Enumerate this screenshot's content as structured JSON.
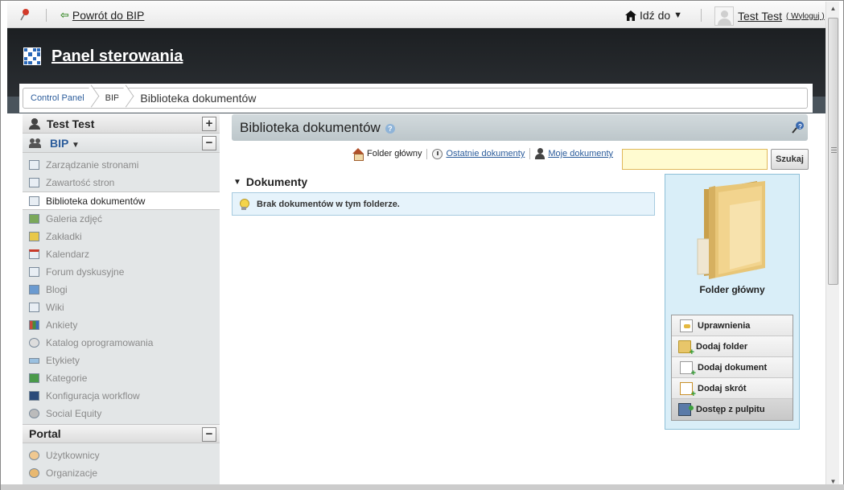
{
  "dock": {
    "back_label": "Powrót do BIP",
    "goto_label": "Idź do",
    "user_name": "Test Test",
    "logout_label": "( Wyloguj )"
  },
  "header": {
    "title": "Panel sterowania"
  },
  "breadcrumb": {
    "items": [
      "Control Panel",
      "BIP",
      "Biblioteka dokumentów"
    ]
  },
  "sidebar": {
    "user_section": "Test Test",
    "site_name": "BIP",
    "site_items": [
      {
        "label": "Zarządzanie stronami",
        "icon": "pages-icon"
      },
      {
        "label": "Zawartość stron",
        "icon": "content-icon"
      },
      {
        "label": "Biblioteka dokumentów",
        "icon": "document-library-icon",
        "selected": true
      },
      {
        "label": "Galeria zdjęć",
        "icon": "image-gallery-icon"
      },
      {
        "label": "Zakładki",
        "icon": "bookmarks-icon"
      },
      {
        "label": "Kalendarz",
        "icon": "calendar-icon"
      },
      {
        "label": "Forum dyskusyjne",
        "icon": "message-board-icon"
      },
      {
        "label": "Blogi",
        "icon": "blogs-icon"
      },
      {
        "label": "Wiki",
        "icon": "wiki-icon"
      },
      {
        "label": "Ankiety",
        "icon": "polls-icon"
      },
      {
        "label": "Katalog oprogramowania",
        "icon": "software-catalog-icon"
      },
      {
        "label": "Etykiety",
        "icon": "tags-icon"
      },
      {
        "label": "Kategorie",
        "icon": "categories-icon"
      },
      {
        "label": "Konfiguracja workflow",
        "icon": "workflow-icon"
      },
      {
        "label": "Social Equity",
        "icon": "social-equity-icon"
      }
    ],
    "portal_label": "Portal",
    "portal_items": [
      {
        "label": "Użytkownicy",
        "icon": "users-icon"
      },
      {
        "label": "Organizacje",
        "icon": "organizations-icon"
      }
    ]
  },
  "main": {
    "title": "Biblioteka dokumentów",
    "nav": {
      "root": "Folder główny",
      "recent": "Ostatnie dokumenty",
      "mine": "Moje dokumenty"
    },
    "search": {
      "value": "",
      "button": "Szukaj"
    },
    "docs_heading": "Dokumenty",
    "empty_message": "Brak dokumentów w tym folderze.",
    "folder": {
      "name": "Folder główny",
      "actions": [
        "Uprawnienia",
        "Dodaj folder",
        "Dodaj dokument",
        "Dodaj skrót",
        "Dostęp z pulpitu"
      ]
    }
  },
  "colors": {
    "link": "#2b5c9b",
    "header_bg": "#1c1f22",
    "sidebar_bg": "#e3e6e7",
    "info_bg": "#e6f3fb",
    "search_bg": "#fffbd0"
  }
}
